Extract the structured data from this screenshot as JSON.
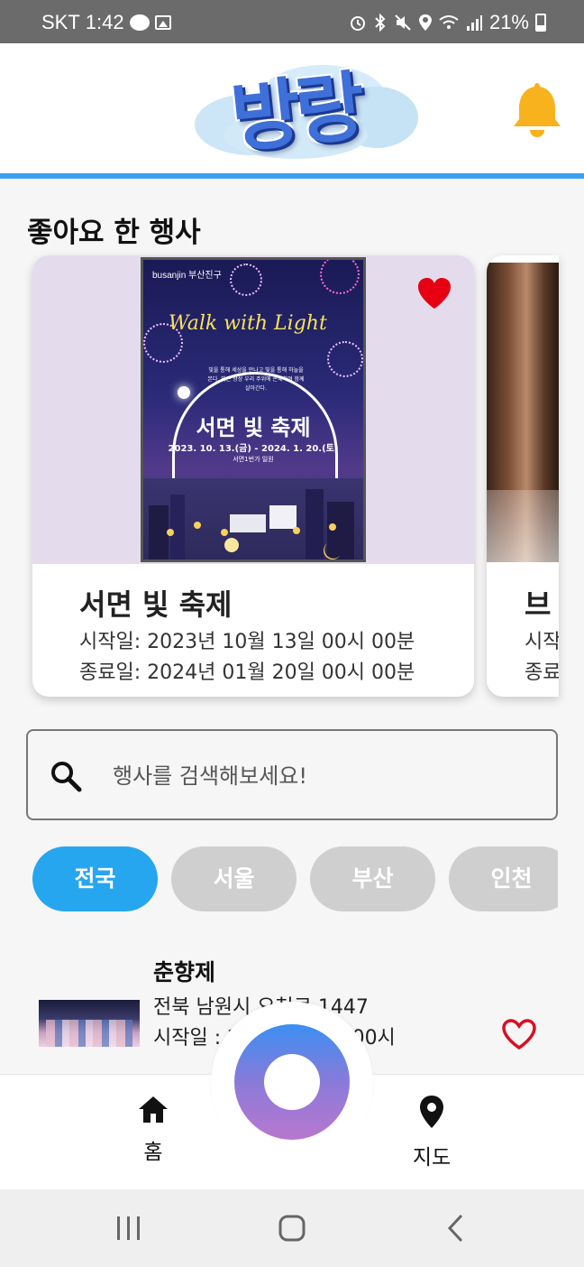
{
  "status_bar": {
    "carrier": "SKT",
    "time": "1:42",
    "battery": "21%"
  },
  "header": {
    "logo_text": "방랑",
    "notification_icon": "bell-icon"
  },
  "liked": {
    "title": "좋아요 한 행사",
    "cards": [
      {
        "title": "서면 빛 축제",
        "start": "시작일: 2023년 10월 13일 00시 00분",
        "end": "종료일: 2024년 01월 20일 00시 00분",
        "poster": {
          "brand": "busanjin 부산진구",
          "headline": "Walk with Light",
          "subtitle": "빛을 통해 세상을 만나고 빛을 통해 하늘을 본다. 빛은 항상 우리 주위에 존재하며 함께 살아간다.",
          "title": "서면 빛 축제",
          "dates": "2023. 10. 13.(금) - 2024. 1. 20.(토)",
          "location": "서면1번가 일원"
        },
        "liked": true
      },
      {
        "title": "브",
        "start": "시작",
        "end": "종료"
      }
    ]
  },
  "search": {
    "placeholder": "행사를 검색해보세요!"
  },
  "regions": [
    "전국",
    "서울",
    "부산",
    "인천"
  ],
  "regions_active": "전국",
  "events": [
    {
      "title": "춘향제",
      "address": "전북 남원시 요천로 1447",
      "start": "시작일 : 2023년 10월 00시"
    }
  ],
  "bottom_nav": {
    "home": "홈",
    "map": "지도"
  },
  "colors": {
    "accent": "#26a6ef",
    "header_line": "#3aa0f0",
    "heart": "#e60012",
    "bell": "#f7b21e"
  }
}
